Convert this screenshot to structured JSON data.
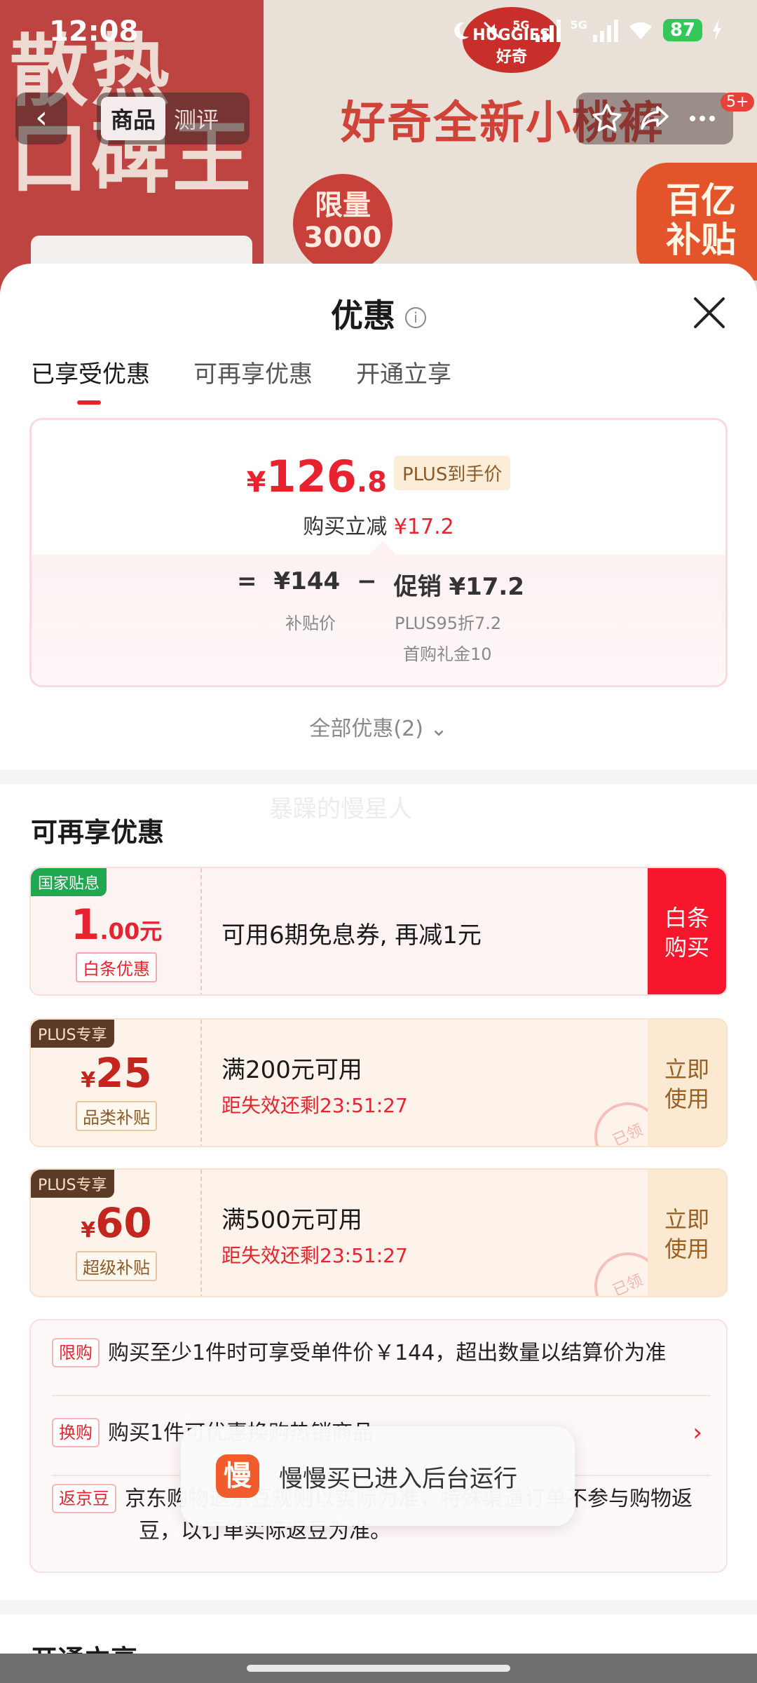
{
  "status_bar": {
    "time": "12:08",
    "net1": "5G",
    "net2": "5G",
    "battery": "87"
  },
  "background": {
    "big_text_line1": "散热",
    "big_text_line2": "口碑王",
    "headline": "好奇全新小桃裤",
    "brand": "HUGGIES",
    "brand_cn": "好奇",
    "limit_line1": "限量",
    "limit_line2": "3000",
    "subsidy_line1": "百亿",
    "subsidy_line2": "补贴"
  },
  "nav": {
    "back_icon": "chevron-left-icon",
    "tab_product": "商品",
    "tab_review": "测评",
    "badge": "5+"
  },
  "sheet": {
    "title": "优惠",
    "tabs": [
      "已享受优惠",
      "可再享优惠",
      "开通立享"
    ],
    "summary": {
      "currency": "¥",
      "price_int": "126",
      "price_dec": ".8",
      "plus_tag": "PLUS到手价",
      "discount_label": "购买立减",
      "discount_value": "¥17.2",
      "eq": "=",
      "base_price": "¥144",
      "base_label": "补贴价",
      "minus": "−",
      "promo_label": "促销",
      "promo_value": "¥17.2",
      "promo_sub1": "PLUS95折7.2",
      "promo_sub2": "首购礼金10"
    },
    "all_offers": "全部优惠(2)",
    "section_title": "可再享优惠",
    "watermark": "暴躁的慢星人",
    "coupons": [
      {
        "corner": "国家贴息",
        "amount_int": "1",
        "amount_dec": ".00元",
        "tag": "白条优惠",
        "desc": "可用6期免息券, 再减1元",
        "cta_line1": "白条",
        "cta_line2": "购买"
      },
      {
        "corner": "PLUS专享",
        "currency": "¥",
        "amount": "25",
        "tag": "品类补贴",
        "desc": "满200元可用",
        "expire": "距失效还剩23:51:27",
        "cta_line1": "立即",
        "cta_line2": "使用",
        "stamp": "已领"
      },
      {
        "corner": "PLUS专享",
        "currency": "¥",
        "amount": "60",
        "tag": "超级补贴",
        "desc": "满500元可用",
        "expire": "距失效还剩23:51:27",
        "cta_line1": "立即",
        "cta_line2": "使用",
        "stamp": "已领"
      }
    ],
    "rules": [
      {
        "tag": "限购",
        "text": "购买至少1件时可享受单件价￥144，超出数量以结算价为准"
      },
      {
        "tag": "换购",
        "text": "购买1件可优惠换购热销商品"
      },
      {
        "tag": "返京豆",
        "text": "京东购物返京豆规则以实际为准，特殊渠道订单不参与购物返豆，以订单实际返豆为准。"
      }
    ],
    "bottom_section_title": "开通立享"
  },
  "toast": {
    "icon_char": "慢",
    "text": "慢慢买已进入后台运行"
  },
  "colors": {
    "accent_red": "#e8232f",
    "plus_brown": "#5b3a28",
    "gov_green": "#1fa84f"
  }
}
